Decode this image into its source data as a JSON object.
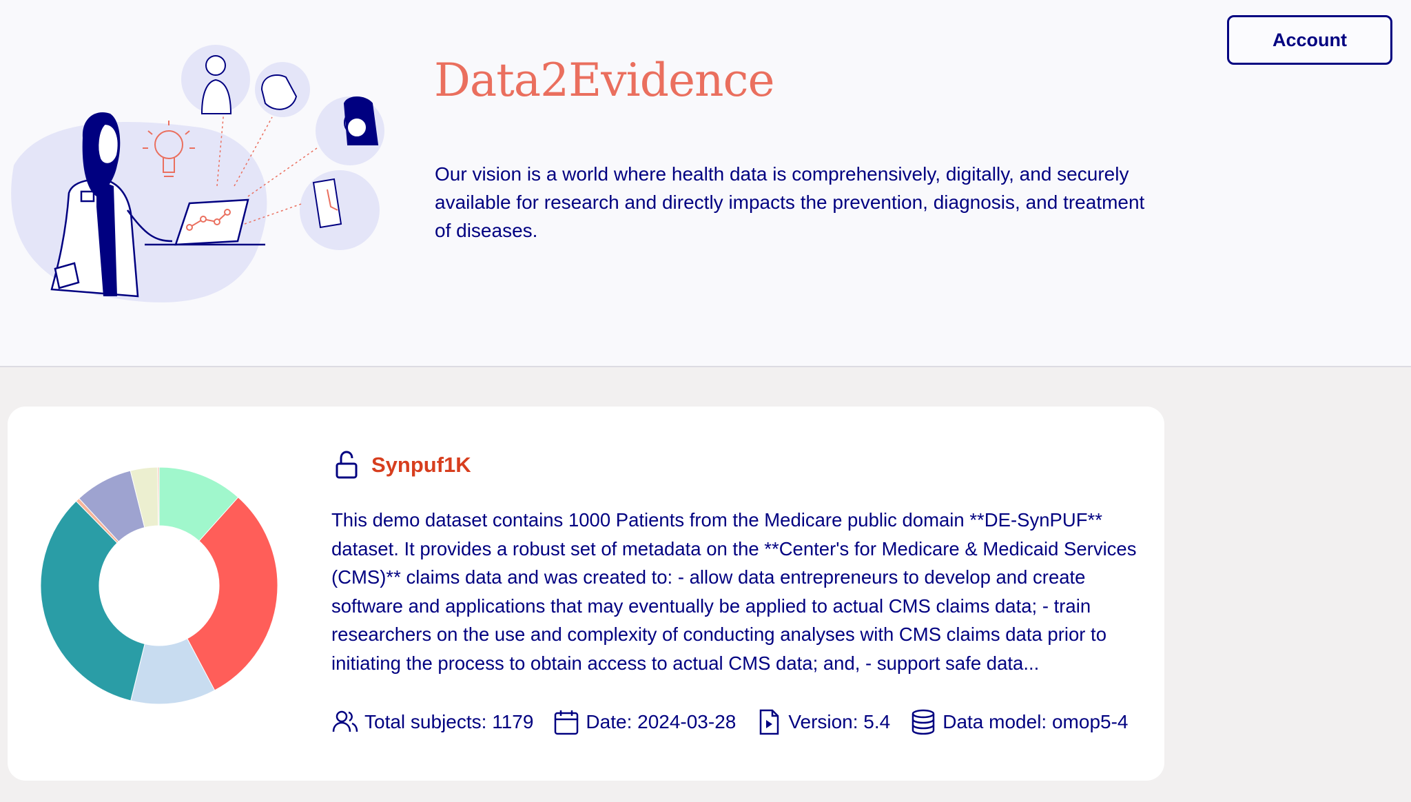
{
  "header": {
    "title": "Data2Evidence",
    "vision": "Our vision is a world where health data is comprehensively, digitally, and securely available for research and directly impacts the prevention, diagnosis, and treatment of diseases.",
    "account_label": "Account"
  },
  "dataset": {
    "name": "Synpuf1K",
    "lock_icon": "unlock-icon",
    "description": "This demo dataset contains 1000 Patients from the Medicare public domain **DE-SynPUF** dataset. It provides a robust set of metadata on the **Center's for Medicare & Medicaid Services (CMS)** claims data and was created to: - allow data entrepreneurs to develop and create software and applications that may eventually be applied to actual CMS claims data; - train researchers on the use and complexity of conducting analyses with CMS claims data prior to initiating the process to obtain access to actual CMS data; and, - support safe data...",
    "meta": {
      "subjects": "Total subjects: 1179",
      "date": "Date: 2024-03-28",
      "version": "Version: 5.4",
      "model": "Data model: omop5-4"
    }
  },
  "chart_data": {
    "type": "pie",
    "title": "",
    "values": [
      11,
      29,
      11,
      32,
      0.5,
      7.5,
      3.5,
      0.2
    ],
    "colors": [
      "#a0f7cc",
      "#ff5e59",
      "#c8dcf0",
      "#2a9da6",
      "#f6b59a",
      "#9ea3d0",
      "#ecefd0",
      "#f4c4b4"
    ]
  },
  "colors": {
    "brand": "#ea6f5e",
    "navy": "#000080",
    "dataset_name": "#d73e1e"
  }
}
